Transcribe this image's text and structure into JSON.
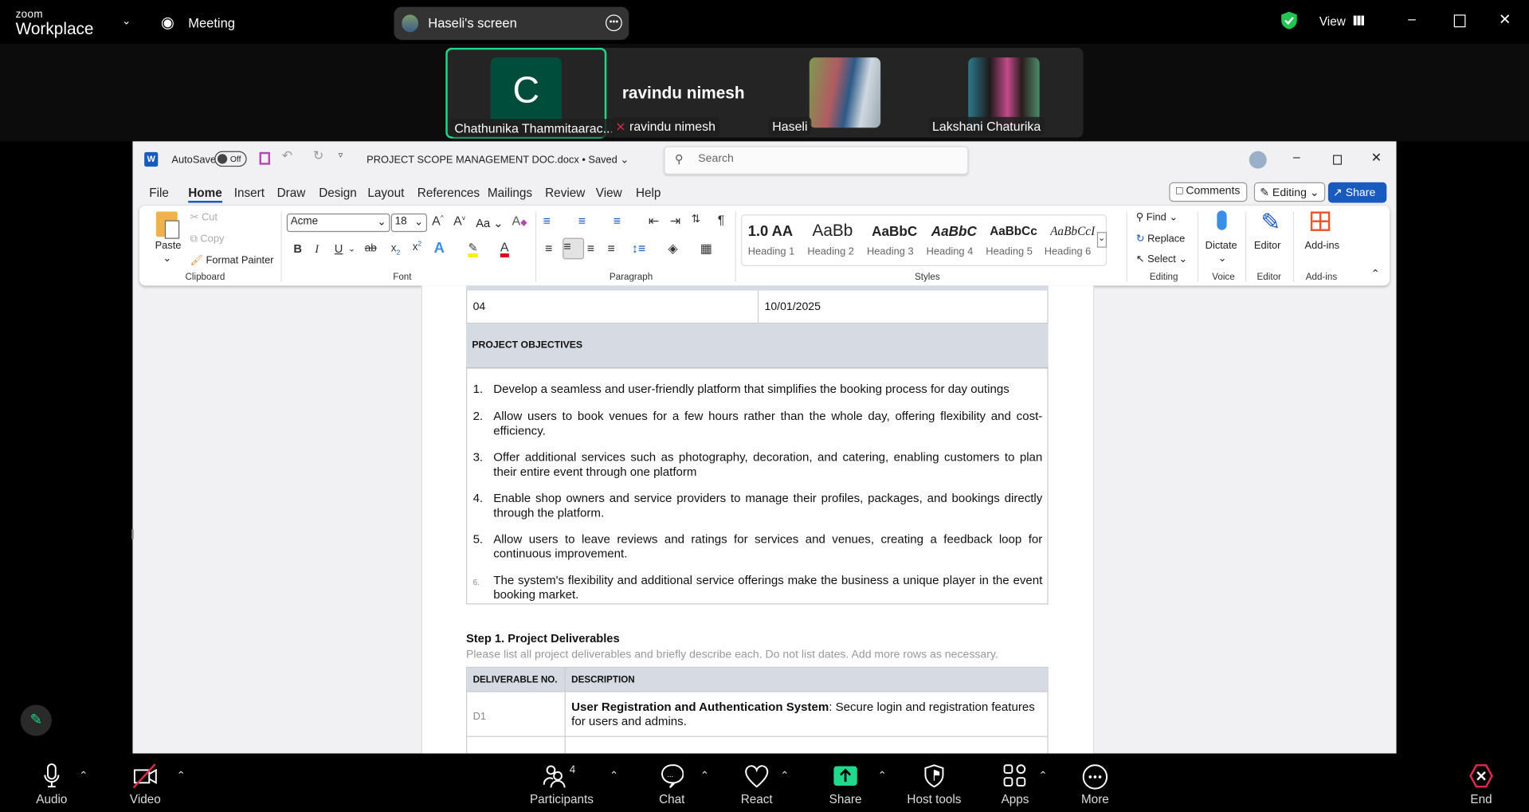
{
  "zoom": {
    "logo_small": "zoom",
    "logo_big": "Workplace",
    "meeting_label": "Meeting",
    "share_pill": "Haseli's screen",
    "view_label": "View",
    "colors": {
      "accent_green": "#22d68a",
      "end_red": "#e02b4f",
      "share_green": "#20d98b"
    }
  },
  "participants": [
    {
      "name": "Chathunika Thammitaarac...",
      "avatar_letter": "C",
      "active_speaker": true
    },
    {
      "name": "ravindu nimesh",
      "display_name": "ravindu nimesh",
      "muted": true
    },
    {
      "name": "Haseli"
    },
    {
      "name": "Lakshani Chaturika"
    }
  ],
  "word": {
    "autosave_label": "AutoSave",
    "autosave_state": "Off",
    "doc_title": "PROJECT SCOPE MANAGEMENT DOC.docx • Saved",
    "search_placeholder": "Search",
    "tabs": [
      "File",
      "Home",
      "Insert",
      "Draw",
      "Design",
      "Layout",
      "References",
      "Mailings",
      "Review",
      "View",
      "Help"
    ],
    "active_tab": "Home",
    "comments_label": "Comments",
    "editing_label": "Editing",
    "share_label": "Share",
    "ribbon": {
      "paste": "Paste",
      "cut": "Cut",
      "copy": "Copy",
      "format_painter": "Format Painter",
      "clipboard": "Clipboard",
      "font_name": "Acme",
      "font_size": "18",
      "change_case": "Aa",
      "font_group": "Font",
      "paragraph_group": "Paragraph",
      "styles": [
        {
          "preview": "1.0 AA",
          "label": "Heading 1"
        },
        {
          "preview": "AaBb",
          "label": "Heading 2"
        },
        {
          "preview": "AaBbC",
          "label": "Heading 3"
        },
        {
          "preview": "AaBbC",
          "label": "Heading 4"
        },
        {
          "preview": "AaBbCc",
          "label": "Heading 5"
        },
        {
          "preview": "AaBbCcI",
          "label": "Heading 6"
        }
      ],
      "styles_group": "Styles",
      "find": "Find",
      "replace": "Replace",
      "select": "Select",
      "editing_group": "Editing",
      "dictate": "Dictate",
      "voice_group": "Voice",
      "editor": "Editor",
      "editor_group": "Editor",
      "addins": "Add-ins",
      "addins_group": "Add-ins"
    }
  },
  "document": {
    "row_04": {
      "left": "04",
      "right": "10/01/2025"
    },
    "objectives_header": "PROJECT OBJECTIVES",
    "objectives": [
      {
        "n": "1.",
        "text": "Develop a seamless and user-friendly platform that simplifies the booking process for day outings"
      },
      {
        "n": "2.",
        "text": "Allow users to book venues for a few hours rather than the whole day, offering flexibility and cost-efficiency."
      },
      {
        "n": "3.",
        "text": "Offer additional services such as photography, decoration, and catering, enabling customers to plan their entire event through one platform"
      },
      {
        "n": "4.",
        "text": "Enable shop owners and service providers to manage their profiles, packages, and bookings directly through the platform."
      },
      {
        "n": "5.",
        "text": "Allow users to leave reviews and ratings for services and venues, creating a feedback loop for continuous improvement."
      },
      {
        "n": "6.",
        "text": "The system's flexibility and additional service offerings make the business a unique player in the event booking market."
      }
    ],
    "step_heading": "Step 1. Project Deliverables",
    "step_instructions": "Please list all project deliverables and briefly describe each. Do not list dates. Add more rows as necessary.",
    "deliverables_headers": [
      "DELIVERABLE NO.",
      "DESCRIPTION"
    ],
    "deliverables": [
      {
        "no": "D1",
        "title": "User Registration and Authentication System",
        "desc": ": Secure login and registration features for users and admins."
      }
    ]
  },
  "toolbar": {
    "audio": "Audio",
    "video": "Video",
    "participants": "Participants",
    "participants_count": "4",
    "chat": "Chat",
    "react": "React",
    "share": "Share",
    "host_tools": "Host tools",
    "apps": "Apps",
    "more": "More",
    "end": "End"
  }
}
